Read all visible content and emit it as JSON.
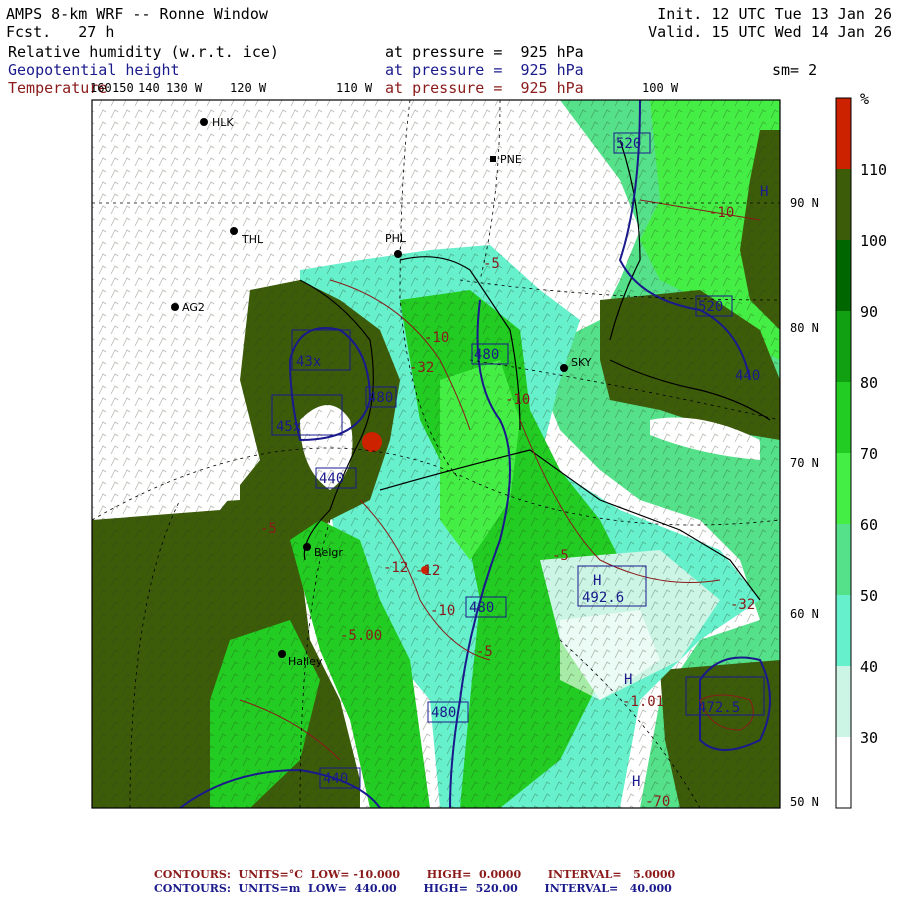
{
  "header": {
    "title": "AMPS 8-km WRF -- Ronne Window",
    "fcst": "Fcst.   27 h",
    "init": "Init. 12 UTC Tue 13 Jan 26",
    "valid": "Valid. 15 UTC Wed 14 Jan 26",
    "fields": [
      {
        "name": "Relative humidity (w.r.t. ice)",
        "level": "at pressure =  925 hPa",
        "color": "#000000"
      },
      {
        "name": "Geopotential height",
        "level": "at pressure =  925 hPa",
        "color": "#1a1a8c"
      },
      {
        "name": "Temperature",
        "level": "at pressure =  925 hPa",
        "color": "#8b1a1a"
      }
    ],
    "smoothing": "sm= 2"
  },
  "longitude_labels": [
    "160",
    "150",
    "140",
    "130 W",
    "120 W",
    "110 W",
    "100 W"
  ],
  "latitude_labels": [
    "90 N",
    "80 N",
    "70 N",
    "60 N",
    "50 N"
  ],
  "stations": [
    "HLK",
    "PNE",
    "THL",
    "PHL",
    "AG2",
    "SKY",
    "Belgr",
    "Halley"
  ],
  "height_labels": [
    "520",
    "520",
    "480",
    "440",
    "440",
    "480",
    "480",
    "480",
    "440",
    "472.5",
    "492.6",
    "45x",
    "43x"
  ],
  "temperature_labels": [
    "-5",
    "-10",
    "-12",
    "-10",
    "-5",
    "-5",
    "-10",
    "-12",
    "-10",
    "-5",
    "-32",
    "-1.01",
    "-5.00",
    "-70"
  ],
  "high_markers": [
    "H",
    "H",
    "H",
    "H"
  ],
  "colorbar": {
    "unit": "%",
    "ticks": [
      "110",
      "100",
      "90",
      "80",
      "70",
      "60",
      "50",
      "40",
      "30"
    ],
    "colors": [
      "#ffffff",
      "#ccf5e6",
      "#66f0cc",
      "#55e08a",
      "#44ee44",
      "#22cc22",
      "#11a011",
      "#006600",
      "#3d5c0a",
      "#cc2200"
    ]
  },
  "footer": {
    "temp": "CONTOURS:  UNITS=°C  LOW= -10.000       HIGH=  0.0000       INTERVAL=   5.0000",
    "height": "CONTOURS:  UNITS=m  LOW=  440.00       HIGH=  520.00       INTERVAL=   40.000"
  },
  "colors": {
    "temp": "#8b1a1a",
    "height": "#1a1a8c",
    "land": "#3d5c0a"
  }
}
